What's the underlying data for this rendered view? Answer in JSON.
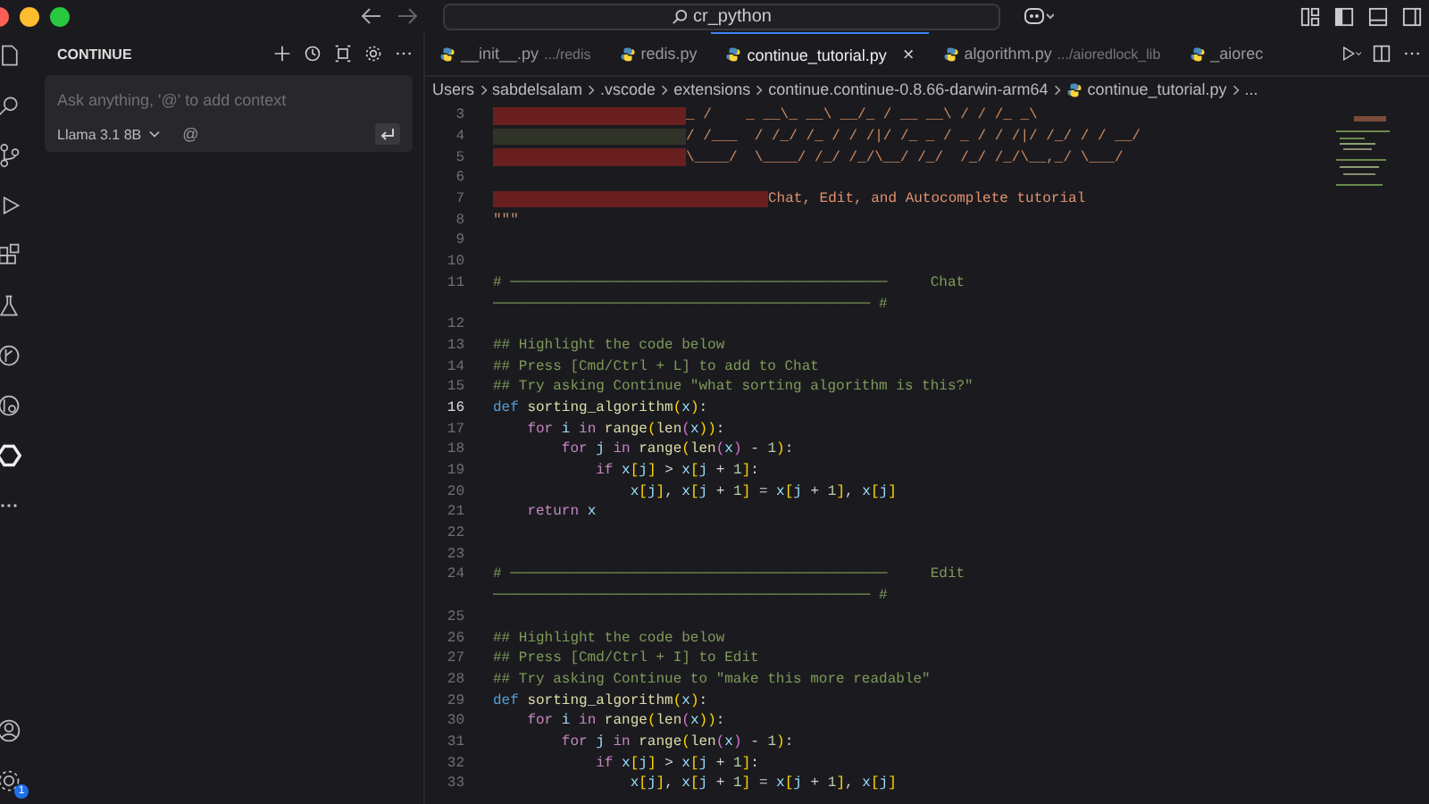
{
  "title_bar": {
    "search_text": "cr_python"
  },
  "activity_bar": {
    "settings_badge": "1"
  },
  "sidebar": {
    "title": "CONTINUE",
    "input": {
      "placeholder": "Ask anything, '@' to add context"
    },
    "model": "Llama 3.1 8B",
    "mention": "@"
  },
  "tabs": [
    {
      "label": "__init__.py",
      "path": ".../redis",
      "selected": false
    },
    {
      "label": "redis.py",
      "selected": false
    },
    {
      "label": "continue_tutorial.py",
      "selected": true,
      "close": "×"
    },
    {
      "label": "algorithm.py",
      "path": ".../aioredlock_lib",
      "selected": false
    },
    {
      "label": "_aiorec",
      "selected": false
    }
  ],
  "breadcrumb": [
    "Users",
    "sabdelsalam",
    ".vscode",
    "extensions",
    "continue.continue-0.8.66-darwin-arm64",
    "continue_tutorial.py",
    "..."
  ],
  "lines": [
    {
      "num": "3",
      "kind": "art_short",
      "text": "_ /    _ __\\_ __\\ __/_ / __ __\\ / / /_ _\\"
    },
    {
      "num": "4",
      "kind": "art_dim",
      "text": "/ /___  / /_/ /_ / / /|/ /_ _ / _ / / /|/ /_/ / / __/"
    },
    {
      "num": "5",
      "kind": "art_short",
      "text": "\\____/  \\____/ /_/ /_/\\__/ /_/  /_/ /_/\\__,_/ \\___/"
    },
    {
      "num": "6",
      "kind": "blank"
    },
    {
      "num": "7",
      "kind": "art_long",
      "text": "Chat, Edit, and Autocomplete tutorial"
    },
    {
      "num": "8",
      "kind": "code",
      "tokens": [
        {
          "text": "\"\"\"",
          "kind": "string"
        }
      ]
    },
    {
      "num": "9",
      "kind": "blank"
    },
    {
      "num": "10",
      "kind": "blank"
    },
    {
      "num": "11",
      "kind": "section",
      "text": "# ────────────────────────────────────────────",
      "label": "Chat",
      "wrap": "──────────────────────────────────────────── #"
    },
    {
      "num": "12",
      "kind": "blank"
    },
    {
      "num": "13",
      "kind": "code",
      "tokens": [
        {
          "text": "## Highlight the code below",
          "kind": "comment"
        }
      ]
    },
    {
      "num": "14",
      "kind": "code",
      "tokens": [
        {
          "text": "## Press [Cmd/Ctrl + L] to add to Chat",
          "kind": "comment"
        }
      ]
    },
    {
      "num": "15",
      "kind": "code",
      "tokens": [
        {
          "text": "## Try asking Continue \"what sorting algorithm is this?\"",
          "kind": "comment"
        }
      ]
    },
    {
      "num": "16",
      "kind": "code",
      "current": true,
      "tokens": [
        {
          "text": "def",
          "kind": "def"
        },
        {
          "text": " sorting_algorithm",
          "kind": "func"
        },
        {
          "text": "(",
          "kind": "bracket"
        },
        {
          "text": "x",
          "kind": "var"
        },
        {
          "text": ")",
          "kind": "bracket"
        },
        {
          "text": ":",
          "kind": "plain"
        }
      ]
    },
    {
      "num": "17",
      "kind": "code",
      "tokens": [
        {
          "text": "    for",
          "kind": "kw"
        },
        {
          "text": " i ",
          "kind": "var"
        },
        {
          "text": "in",
          "kind": "kw"
        },
        {
          "text": " range",
          "kind": "func"
        },
        {
          "text": "(",
          "kind": "bracket"
        },
        {
          "text": "len",
          "kind": "func"
        },
        {
          "text": "(",
          "kind": "bracket2"
        },
        {
          "text": "x",
          "kind": "var"
        },
        {
          "text": "))",
          "kind": "bracket"
        },
        {
          "text": ":",
          "kind": "plain"
        }
      ]
    },
    {
      "num": "18",
      "kind": "code",
      "tokens": [
        {
          "text": "        for",
          "kind": "kw"
        },
        {
          "text": " j ",
          "kind": "var"
        },
        {
          "text": "in",
          "kind": "kw"
        },
        {
          "text": " range",
          "kind": "func"
        },
        {
          "text": "(",
          "kind": "bracket"
        },
        {
          "text": "len",
          "kind": "func"
        },
        {
          "text": "(",
          "kind": "bracket2"
        },
        {
          "text": "x",
          "kind": "var"
        },
        {
          "text": ")",
          "kind": "bracket2"
        },
        {
          "text": " - ",
          "kind": "plain"
        },
        {
          "text": "1",
          "kind": "num"
        },
        {
          "text": ")",
          "kind": "bracket"
        },
        {
          "text": ":",
          "kind": "plain"
        }
      ]
    },
    {
      "num": "19",
      "kind": "code",
      "tokens": [
        {
          "text": "            if",
          "kind": "kw"
        },
        {
          "text": " x",
          "kind": "var"
        },
        {
          "text": "[",
          "kind": "bracket"
        },
        {
          "text": "j",
          "kind": "var"
        },
        {
          "text": "]",
          "kind": "bracket"
        },
        {
          "text": " > ",
          "kind": "plain"
        },
        {
          "text": "x",
          "kind": "var"
        },
        {
          "text": "[",
          "kind": "bracket"
        },
        {
          "text": "j",
          "kind": "var"
        },
        {
          "text": " + ",
          "kind": "plain"
        },
        {
          "text": "1",
          "kind": "num"
        },
        {
          "text": "]",
          "kind": "bracket"
        },
        {
          "text": ":",
          "kind": "plain"
        }
      ]
    },
    {
      "num": "20",
      "kind": "code",
      "tokens": [
        {
          "text": "                x",
          "kind": "var"
        },
        {
          "text": "[",
          "kind": "bracket"
        },
        {
          "text": "j",
          "kind": "var"
        },
        {
          "text": "]",
          "kind": "bracket"
        },
        {
          "text": ", ",
          "kind": "plain"
        },
        {
          "text": "x",
          "kind": "var"
        },
        {
          "text": "[",
          "kind": "bracket"
        },
        {
          "text": "j",
          "kind": "var"
        },
        {
          "text": " + ",
          "kind": "plain"
        },
        {
          "text": "1",
          "kind": "num"
        },
        {
          "text": "]",
          "kind": "bracket"
        },
        {
          "text": " = ",
          "kind": "plain"
        },
        {
          "text": "x",
          "kind": "var"
        },
        {
          "text": "[",
          "kind": "bracket"
        },
        {
          "text": "j",
          "kind": "var"
        },
        {
          "text": " + ",
          "kind": "plain"
        },
        {
          "text": "1",
          "kind": "num"
        },
        {
          "text": "]",
          "kind": "bracket"
        },
        {
          "text": ", ",
          "kind": "plain"
        },
        {
          "text": "x",
          "kind": "var"
        },
        {
          "text": "[",
          "kind": "bracket"
        },
        {
          "text": "j",
          "kind": "var"
        },
        {
          "text": "]",
          "kind": "bracket"
        }
      ]
    },
    {
      "num": "21",
      "kind": "code",
      "tokens": [
        {
          "text": "    return",
          "kind": "kw"
        },
        {
          "text": " x",
          "kind": "var"
        }
      ]
    },
    {
      "num": "22",
      "kind": "blank"
    },
    {
      "num": "23",
      "kind": "blank"
    },
    {
      "num": "24",
      "kind": "section",
      "text": "# ────────────────────────────────────────────",
      "label": "Edit",
      "wrap": "──────────────────────────────────────────── #"
    },
    {
      "num": "25",
      "kind": "blank"
    },
    {
      "num": "26",
      "kind": "code",
      "tokens": [
        {
          "text": "## Highlight the code below",
          "kind": "comment"
        }
      ]
    },
    {
      "num": "27",
      "kind": "code",
      "tokens": [
        {
          "text": "## Press [Cmd/Ctrl + I] to Edit",
          "kind": "comment"
        }
      ]
    },
    {
      "num": "28",
      "kind": "code",
      "tokens": [
        {
          "text": "## Try asking Continue to \"make this more readable\"",
          "kind": "comment"
        }
      ]
    },
    {
      "num": "29",
      "kind": "code",
      "tokens": [
        {
          "text": "def",
          "kind": "def"
        },
        {
          "text": " sorting_algorithm",
          "kind": "func"
        },
        {
          "text": "(",
          "kind": "bracket"
        },
        {
          "text": "x",
          "kind": "var"
        },
        {
          "text": ")",
          "kind": "bracket"
        },
        {
          "text": ":",
          "kind": "plain"
        }
      ]
    },
    {
      "num": "30",
      "kind": "code",
      "tokens": [
        {
          "text": "    for",
          "kind": "kw"
        },
        {
          "text": " i ",
          "kind": "var"
        },
        {
          "text": "in",
          "kind": "kw"
        },
        {
          "text": " range",
          "kind": "func"
        },
        {
          "text": "(",
          "kind": "bracket"
        },
        {
          "text": "len",
          "kind": "func"
        },
        {
          "text": "(",
          "kind": "bracket2"
        },
        {
          "text": "x",
          "kind": "var"
        },
        {
          "text": "))",
          "kind": "bracket"
        },
        {
          "text": ":",
          "kind": "plain"
        }
      ]
    },
    {
      "num": "31",
      "kind": "code",
      "tokens": [
        {
          "text": "        for",
          "kind": "kw"
        },
        {
          "text": " j ",
          "kind": "var"
        },
        {
          "text": "in",
          "kind": "kw"
        },
        {
          "text": " range",
          "kind": "func"
        },
        {
          "text": "(",
          "kind": "bracket"
        },
        {
          "text": "len",
          "kind": "func"
        },
        {
          "text": "(",
          "kind": "bracket2"
        },
        {
          "text": "x",
          "kind": "var"
        },
        {
          "text": ")",
          "kind": "bracket2"
        },
        {
          "text": " - ",
          "kind": "plain"
        },
        {
          "text": "1",
          "kind": "num"
        },
        {
          "text": ")",
          "kind": "bracket"
        },
        {
          "text": ":",
          "kind": "plain"
        }
      ]
    },
    {
      "num": "32",
      "kind": "code",
      "tokens": [
        {
          "text": "            if",
          "kind": "kw"
        },
        {
          "text": " x",
          "kind": "var"
        },
        {
          "text": "[",
          "kind": "bracket"
        },
        {
          "text": "j",
          "kind": "var"
        },
        {
          "text": "]",
          "kind": "bracket"
        },
        {
          "text": " > ",
          "kind": "plain"
        },
        {
          "text": "x",
          "kind": "var"
        },
        {
          "text": "[",
          "kind": "bracket"
        },
        {
          "text": "j",
          "kind": "var"
        },
        {
          "text": " + ",
          "kind": "plain"
        },
        {
          "text": "1",
          "kind": "num"
        },
        {
          "text": "]",
          "kind": "bracket"
        },
        {
          "text": ":",
          "kind": "plain"
        }
      ]
    },
    {
      "num": "33",
      "kind": "code",
      "tokens": [
        {
          "text": "                x",
          "kind": "var"
        },
        {
          "text": "[",
          "kind": "bracket"
        },
        {
          "text": "j",
          "kind": "var"
        },
        {
          "text": "]",
          "kind": "bracket"
        },
        {
          "text": ", ",
          "kind": "plain"
        },
        {
          "text": "x",
          "kind": "var"
        },
        {
          "text": "[",
          "kind": "bracket"
        },
        {
          "text": "j",
          "kind": "var"
        },
        {
          "text": " + ",
          "kind": "plain"
        },
        {
          "text": "1",
          "kind": "num"
        },
        {
          "text": "]",
          "kind": "bracket"
        },
        {
          "text": " = ",
          "kind": "plain"
        },
        {
          "text": "x",
          "kind": "var"
        },
        {
          "text": "[",
          "kind": "bracket"
        },
        {
          "text": "j",
          "kind": "var"
        },
        {
          "text": " + ",
          "kind": "plain"
        },
        {
          "text": "1",
          "kind": "num"
        },
        {
          "text": "]",
          "kind": "bracket"
        },
        {
          "text": ", ",
          "kind": "plain"
        },
        {
          "text": "x",
          "kind": "var"
        },
        {
          "text": "[",
          "kind": "bracket"
        },
        {
          "text": "j",
          "kind": "var"
        },
        {
          "text": "]",
          "kind": "bracket"
        }
      ]
    }
  ]
}
